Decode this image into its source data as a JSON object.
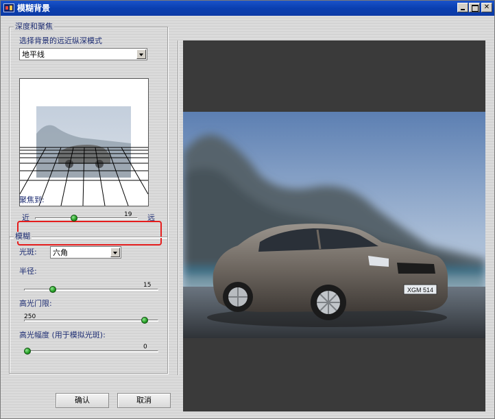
{
  "window": {
    "title": "模糊背景",
    "controls": {
      "minimize": "minimize-icon",
      "maximize": "maximize-icon",
      "close": "close-icon"
    }
  },
  "depth_focus": {
    "group_title": "深度和聚焦",
    "mode_label": "选择背景的远近纵深模式",
    "mode_value": "地平线",
    "focus_label": "聚焦到:",
    "focus_near": "近",
    "focus_far": "远",
    "focus_value": "19",
    "focus_fraction": 0.37
  },
  "blur": {
    "group_title": "模糊",
    "bokeh_label": "光斑:",
    "bokeh_value": "六角",
    "radius_label": "半径:",
    "radius_value": "15",
    "radius_fraction": 0.2,
    "highlight_threshold_label": "高光门限:",
    "highlight_threshold_value": "250",
    "highlight_threshold_fraction": 0.92,
    "highlight_amount_label": "高光幅度 (用于模拟光斑):",
    "highlight_amount_value": "0",
    "highlight_amount_fraction": 0.0
  },
  "buttons": {
    "ok": "确认",
    "cancel": "取消"
  },
  "photo": {
    "plate_text": "XGM 514"
  },
  "colors": {
    "accent_red": "#e51c1c",
    "slider_thumb": "#29a329",
    "title_bar": "#0a3fb0",
    "preview_bg": "#3a3a3a"
  }
}
